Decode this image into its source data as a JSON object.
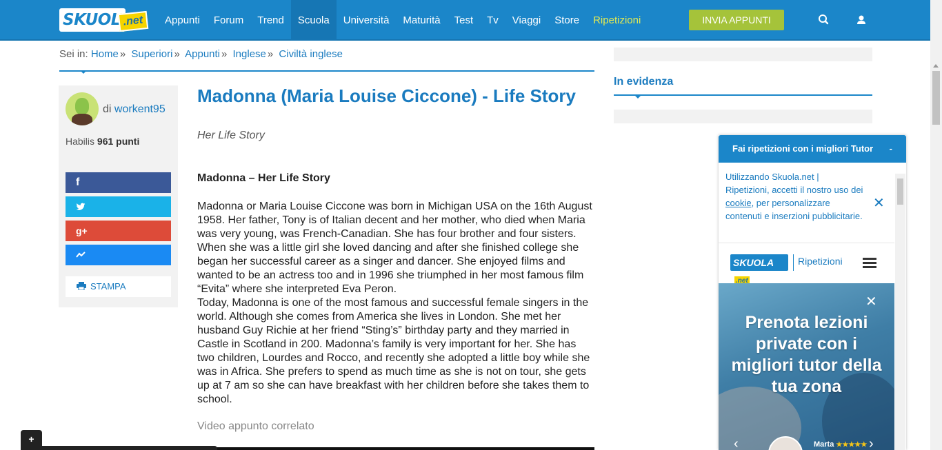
{
  "navbar": {
    "logo_main": "SKUOLA",
    "logo_net": ".net",
    "items": [
      "Appunti",
      "Forum",
      "Trend",
      "Scuola",
      "Università",
      "Maturità",
      "Test",
      "Tv",
      "Viaggi",
      "Store",
      "Ripetizioni"
    ],
    "active_item": "Scuola",
    "highlight_item": "Ripetizioni",
    "invia_label": "INVIA APPUNTI",
    "colors": {
      "bar": "#1b86c9",
      "invia": "#a5c33a",
      "highlight": "#e4ea52"
    }
  },
  "breadcrumb": {
    "prefix": "Sei in:",
    "items": [
      "Home",
      "Superiori",
      "Appunti",
      "Inglese",
      "Civiltà inglese"
    ]
  },
  "author": {
    "di": "di",
    "name": "workent95",
    "rank": "Habilis",
    "points": "961 punti",
    "print_label": "STAMPA"
  },
  "share": {
    "facebook": "f",
    "twitter": "twitter-icon",
    "google": "g+",
    "messenger": "messenger-icon"
  },
  "article": {
    "title": "Madonna (Maria Louise Ciccone) - Life Story",
    "subtitle": "Her Life Story",
    "heading": "Madonna – Her Life Story",
    "paragraph1": "Madonna or Maria Louise Ciccone was born in Michigan USA on the 16th August 1958. Her father, Tony is of Italian decent and her mother, who died when Maria was very young, was French-Canadian. She has four brother and four sisters. When she was a little girl she loved dancing and after she finished college she began her successful career as a singer and dancer. She enjoyed films and wanted to be an actress too and in 1996 she triumphed in her most famous film “Evita” where she interpreted Eva Peron.",
    "paragraph2": "Today, Madonna is one of the most famous and successful female singers in the world. Although she comes from America she lives in London. She met her husband Guy Richie at her friend “Sting’s” birthday party and they married in Castle in Scotland in 200. Madonna’s family is very important for her. She has two children, Lourdes and Rocco, and recently she adopted a little boy while she was in Africa. She prefers to spend as much time as she is not on tour, she gets up at 7 am so she can have breakfast with her children before she takes them to school.",
    "video_label": "Video appunto correlato"
  },
  "sidebar": {
    "in_evidenza": "In evidenza"
  },
  "widget": {
    "header": "Fai ripetizioni con i migliori Tutor",
    "minimize": "-",
    "cookie_pre": "Utilizzando Skuola.net | Ripetizioni, accetti il nostro uso dei ",
    "cookie_link": "cookie",
    "cookie_post": ", per personalizzare contenuti e inserzioni pubblicitarie.",
    "close": "✕",
    "logo_main": "SKUOLA",
    "logo_net": ".net",
    "brand_label": "Ripetizioni",
    "promo_text": "Prenota lezioni private con i migliori tutor della tua zona",
    "tutor_name": "Marta",
    "tutor_stars": "★★★★★"
  },
  "mini_tab": {
    "label": "+"
  }
}
